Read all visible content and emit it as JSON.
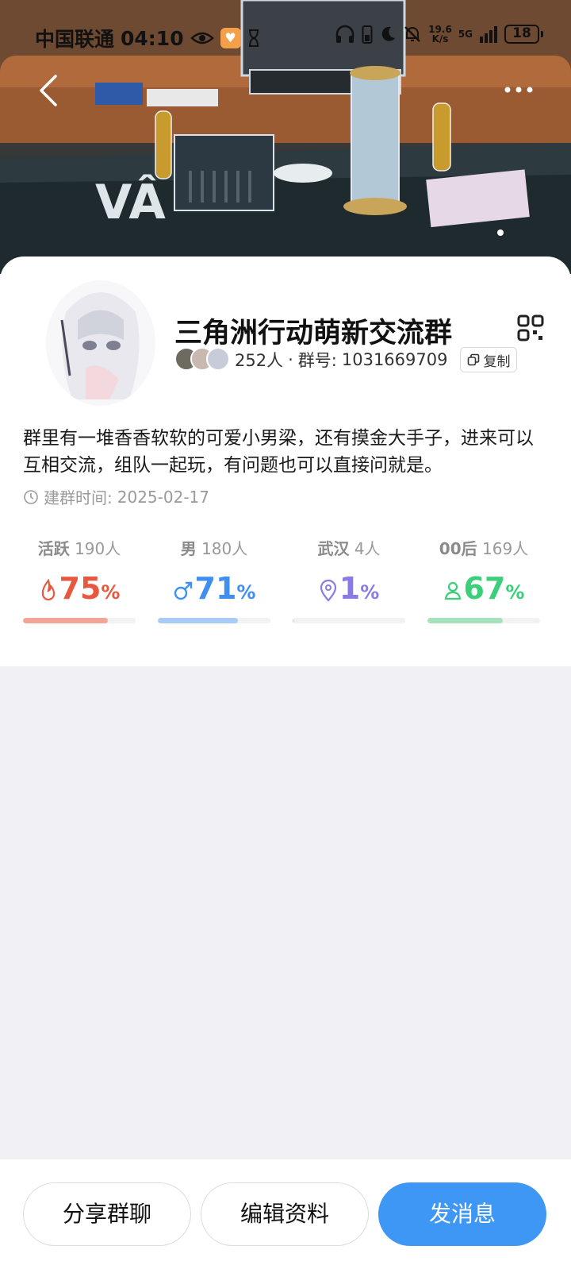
{
  "status_bar": {
    "carrier": "中国联通",
    "time": "04:10",
    "net_speed_value": "19.6",
    "net_speed_unit": "K/s",
    "network": "5G",
    "battery": "18"
  },
  "group": {
    "name": "三角洲行动萌新交流群",
    "members": "252人",
    "separator": "·",
    "group_no_label": "群号:",
    "group_no": "1031669709",
    "copy_label": "复制",
    "description": "群里有一堆香香软软的可爱小男梁，还有摸金大手子，进来可以互相交流，组队一起玩，有问题也可以直接问就是。",
    "created_label": "建群时间:",
    "created_date": "2025-02-17"
  },
  "stats": [
    {
      "label": "活跃",
      "count": "190人",
      "percent": "75",
      "unit": "%",
      "icon": "flame-icon",
      "color": "#e8583f",
      "bar_color": "#f2a596",
      "fill": 0.75
    },
    {
      "label": "男",
      "count": "180人",
      "percent": "71",
      "unit": "%",
      "icon": "male-icon",
      "color": "#3e8ff0",
      "bar_color": "#a9ccf6",
      "fill": 0.71
    },
    {
      "label": "武汉",
      "count": "4人",
      "percent": "1",
      "unit": "%",
      "icon": "location-pin-icon",
      "color": "#8a7ae6",
      "bar_color": "#c9c2f2",
      "fill": 0.01
    },
    {
      "label": "00后",
      "count": "169人",
      "percent": "67",
      "unit": "%",
      "icon": "person-icon",
      "color": "#3ccf7a",
      "bar_color": "#a6e3bd",
      "fill": 0.67
    }
  ],
  "actions": {
    "share": "分享群聊",
    "edit": "编辑资料",
    "send": "发消息"
  },
  "colors": {
    "primary": "#3e97f5",
    "page_bg": "#f1f1f5"
  }
}
